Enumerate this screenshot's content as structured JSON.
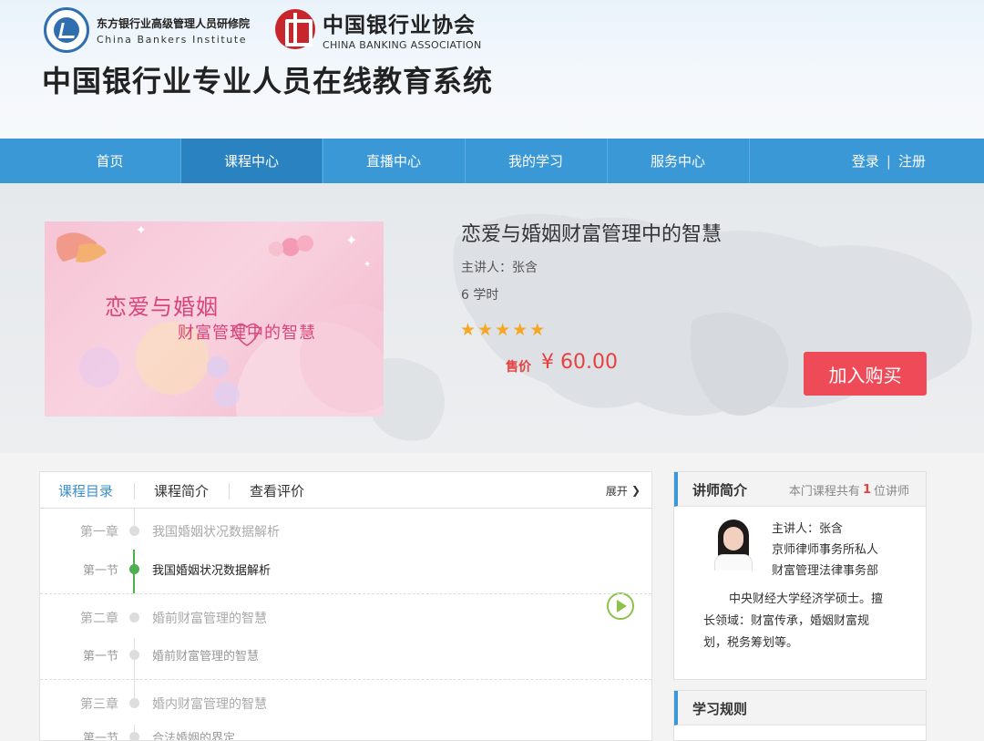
{
  "header": {
    "logo1_cn": "东方银行业高级管理人员研修院",
    "logo1_en": "China Bankers Institute",
    "logo2_cn": "中国银行业协会",
    "logo2_en": "CHINA BANKING ASSOCIATION",
    "site_title": "中国银行业专业人员在线教育系统"
  },
  "nav": {
    "items": [
      "首页",
      "课程中心",
      "直播中心",
      "我的学习",
      "服务中心"
    ],
    "active_index": 1,
    "login": "登录",
    "separator": "|",
    "register": "注册"
  },
  "course": {
    "image_line1": "恋爱与婚姻",
    "image_line2": "财富管理中的智慧",
    "title": "恋爱与婚姻财富管理中的智慧",
    "teacher": "主讲人：张含",
    "hours": "6 学时",
    "rating": 5,
    "price_label": "售价",
    "price": "¥ 60.00",
    "buy_label": "加入购买"
  },
  "tabs": {
    "items": [
      "课程目录",
      "课程简介",
      "查看评价"
    ],
    "expand": "展开"
  },
  "outline": [
    {
      "type": "chapter",
      "label": "第一章",
      "title": "我国婚姻状况数据解析"
    },
    {
      "type": "section",
      "label": "第一节",
      "title": "我国婚姻状况数据解析",
      "active": true
    },
    {
      "type": "chapter",
      "label": "第二章",
      "title": "婚前财富管理的智慧"
    },
    {
      "type": "section",
      "label": "第一节",
      "title": "婚前财富管理的智慧"
    },
    {
      "type": "chapter",
      "label": "第三章",
      "title": "婚内财富管理的智慧"
    },
    {
      "type": "section",
      "label": "第一节",
      "title": "合法婚姻的界定"
    }
  ],
  "instructor": {
    "heading": "讲师简介",
    "count_prefix": "本门课程共有",
    "count": "1",
    "count_suffix": "位讲师",
    "bio_lines": [
      "主讲人：张含",
      "京师律师事务所私人",
      "财富管理法律事务部",
      "中央财经大学经济学硕士。擅",
      "长领域：财富传承，婚姻财富规",
      "划，税务筹划等。"
    ]
  },
  "rules": {
    "heading": "学习规则"
  }
}
